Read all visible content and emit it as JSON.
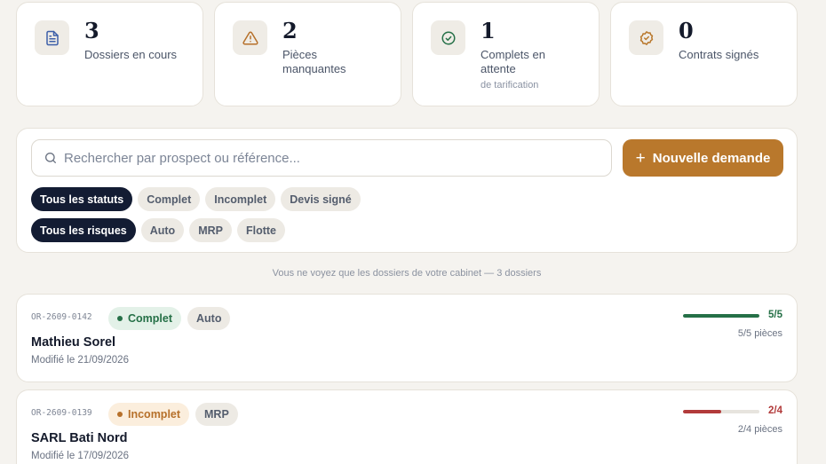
{
  "stats": [
    {
      "icon": "document-icon",
      "value": "3",
      "label": "Dossiers en cours",
      "sub": "",
      "icon_color": "#3d5fa8"
    },
    {
      "icon": "warning-icon",
      "value": "2",
      "label": "Pièces manquantes",
      "sub": "",
      "icon_color": "#b6702a"
    },
    {
      "icon": "check-circle-icon",
      "value": "1",
      "label": "Complets en attente",
      "sub": "de tarification",
      "icon_color": "#257047"
    },
    {
      "icon": "badge-check-icon",
      "value": "0",
      "label": "Contrats signés",
      "sub": "",
      "icon_color": "#b9782c"
    }
  ],
  "search": {
    "placeholder": "Rechercher par prospect ou référence..."
  },
  "new_button": {
    "icon": "plus-icon",
    "label": "Nouvelle demande"
  },
  "status_filters": [
    "Tous les statuts",
    "Complet",
    "Incomplet",
    "Devis signé"
  ],
  "risk_filters": [
    "Tous les risques",
    "Auto",
    "MRP",
    "Flotte"
  ],
  "note": "Vous ne voyez que les dossiers de votre cabinet — 3 dossiers",
  "dossiers": [
    {
      "ref": "OR-2609-0142",
      "status": "Complet",
      "type": "Auto",
      "name": "Mathieu Sorel",
      "modified": "Modifié le 21/09/2026",
      "progress": 1.0,
      "fraction": "5/5",
      "pieces": "5/5 pièces",
      "color": "#257047"
    },
    {
      "ref": "OR-2609-0139",
      "status": "Incomplet",
      "type": "MRP",
      "name": "SARL Bati Nord",
      "modified": "Modifié le 17/09/2026",
      "progress": 0.5,
      "fraction": "2/4",
      "pieces": "2/4 pièces",
      "color": "#b23b3b"
    }
  ],
  "colors": {
    "accent": "#b9782c",
    "navy": "#131c33",
    "background": "#f5f3ef"
  }
}
